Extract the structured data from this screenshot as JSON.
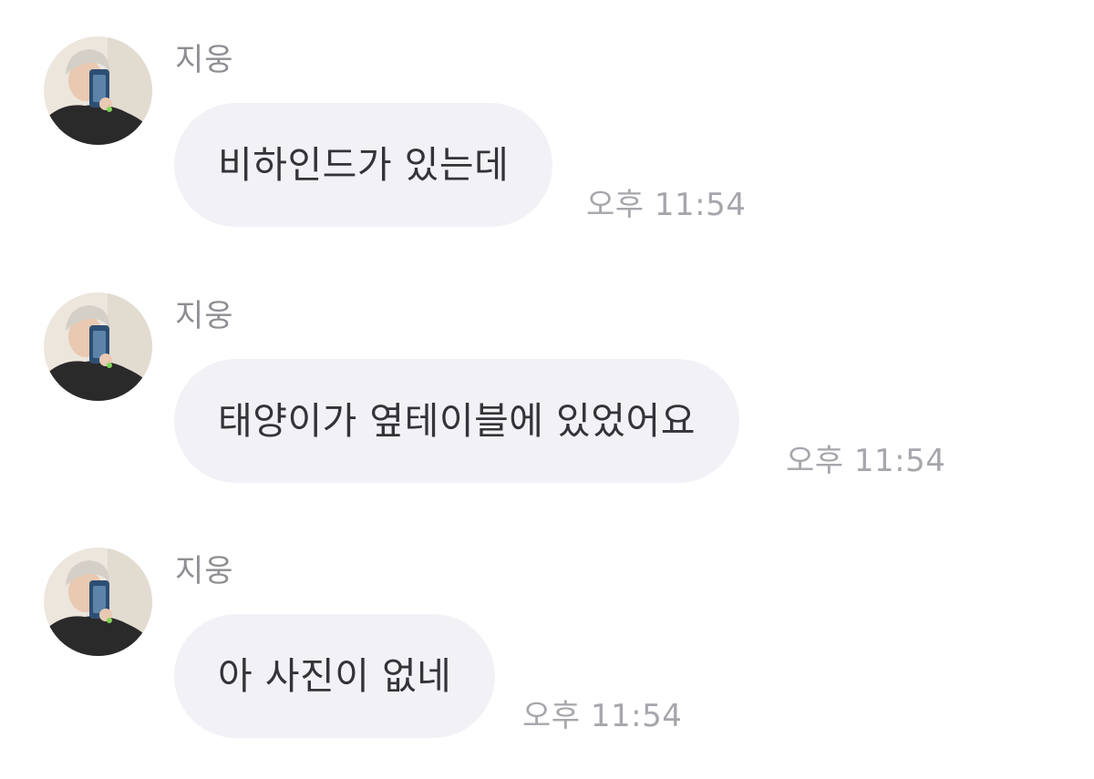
{
  "colors": {
    "bubble_bg": "#f2f2f6",
    "message_text": "#333338",
    "sender_text": "#8e8e93",
    "time_text": "#a6a6ac"
  },
  "messages": [
    {
      "sender": "지웅",
      "avatar_icon": "profile-photo-avatar",
      "text": "비하인드가 있는데",
      "time": "오후 11:54"
    },
    {
      "sender": "지웅",
      "avatar_icon": "profile-photo-avatar",
      "text": "태양이가 옆테이블에 있었어요",
      "time": "오후 11:54"
    },
    {
      "sender": "지웅",
      "avatar_icon": "profile-photo-avatar",
      "text": "아 사진이 없네",
      "time": "오후 11:54"
    }
  ]
}
